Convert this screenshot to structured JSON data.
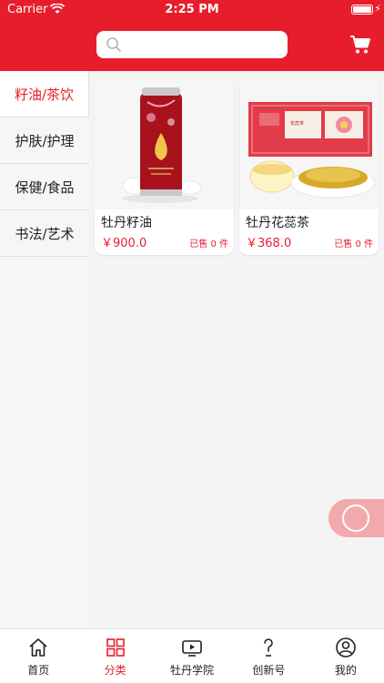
{
  "status": {
    "carrier": "Carrier",
    "time": "2:25 PM"
  },
  "search": {
    "placeholder": ""
  },
  "categories": [
    {
      "label": "籽油/茶饮",
      "active": true
    },
    {
      "label": "护肤/护理",
      "active": false
    },
    {
      "label": "保健/食品",
      "active": false
    },
    {
      "label": "书法/艺术",
      "active": false
    }
  ],
  "products": [
    {
      "name": "牡丹籽油",
      "price": "￥900.0",
      "sold": "已售 0 件"
    },
    {
      "name": "牡丹花蕊茶",
      "price": "￥368.0",
      "sold": "已售 0 件"
    }
  ],
  "tabs": [
    {
      "label": "首页",
      "icon": "home-icon"
    },
    {
      "label": "分类",
      "icon": "grid-icon",
      "active": true
    },
    {
      "label": "牡丹学院",
      "icon": "video-icon"
    },
    {
      "label": "创新号",
      "icon": "question-icon"
    },
    {
      "label": "我的",
      "icon": "user-icon"
    }
  ],
  "colors": {
    "brand": "#e81d2c",
    "floatButton": "#f2a9ad"
  }
}
